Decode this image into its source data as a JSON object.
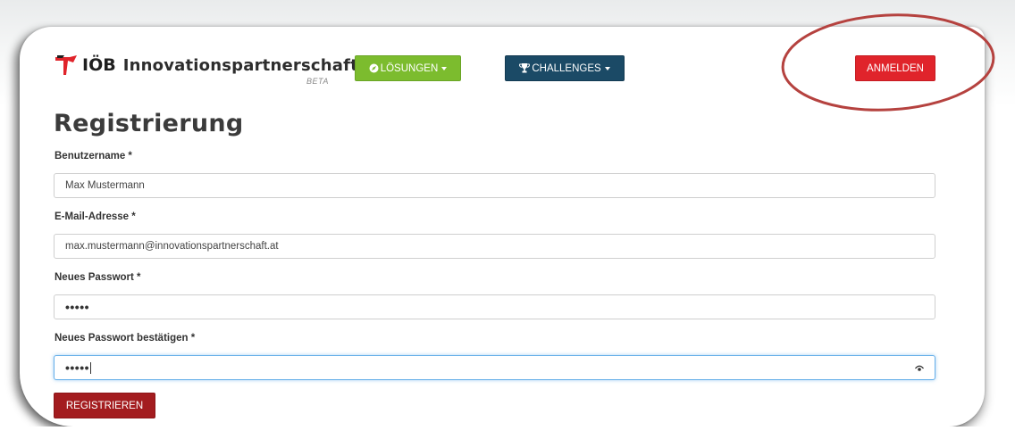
{
  "header": {
    "logo_brand": "IÖB",
    "logo_name": "Innovationspartnerschaft",
    "beta": "BETA",
    "loesungen_label": "LÖSUNGEN",
    "challenges_label": "CHALLENGES",
    "anmelden_label": "ANMELDEN"
  },
  "form": {
    "title": "Registrierung",
    "username": {
      "label": "Benutzername *",
      "value": "Max Mustermann"
    },
    "email": {
      "label": "E-Mail-Adresse *",
      "value": "max.mustermann@innovationspartnerschaft.at"
    },
    "password": {
      "label": "Neues Passwort *",
      "value": "•••••"
    },
    "password_confirm": {
      "label": "Neues Passwort bestätigen *",
      "value": "•••••"
    },
    "submit_label": "REGISTRIEREN"
  },
  "icons": {
    "loesungen": "compass-icon",
    "challenges": "trophy-icon",
    "password_toggle": "eye-icon",
    "logo": "flag-logo"
  },
  "colors": {
    "loesungen": "#7cbc2e",
    "challenges": "#1b4a66",
    "anmelden": "#e0242b",
    "register": "#a31c1f",
    "highlight_oval": "#b5423f"
  }
}
